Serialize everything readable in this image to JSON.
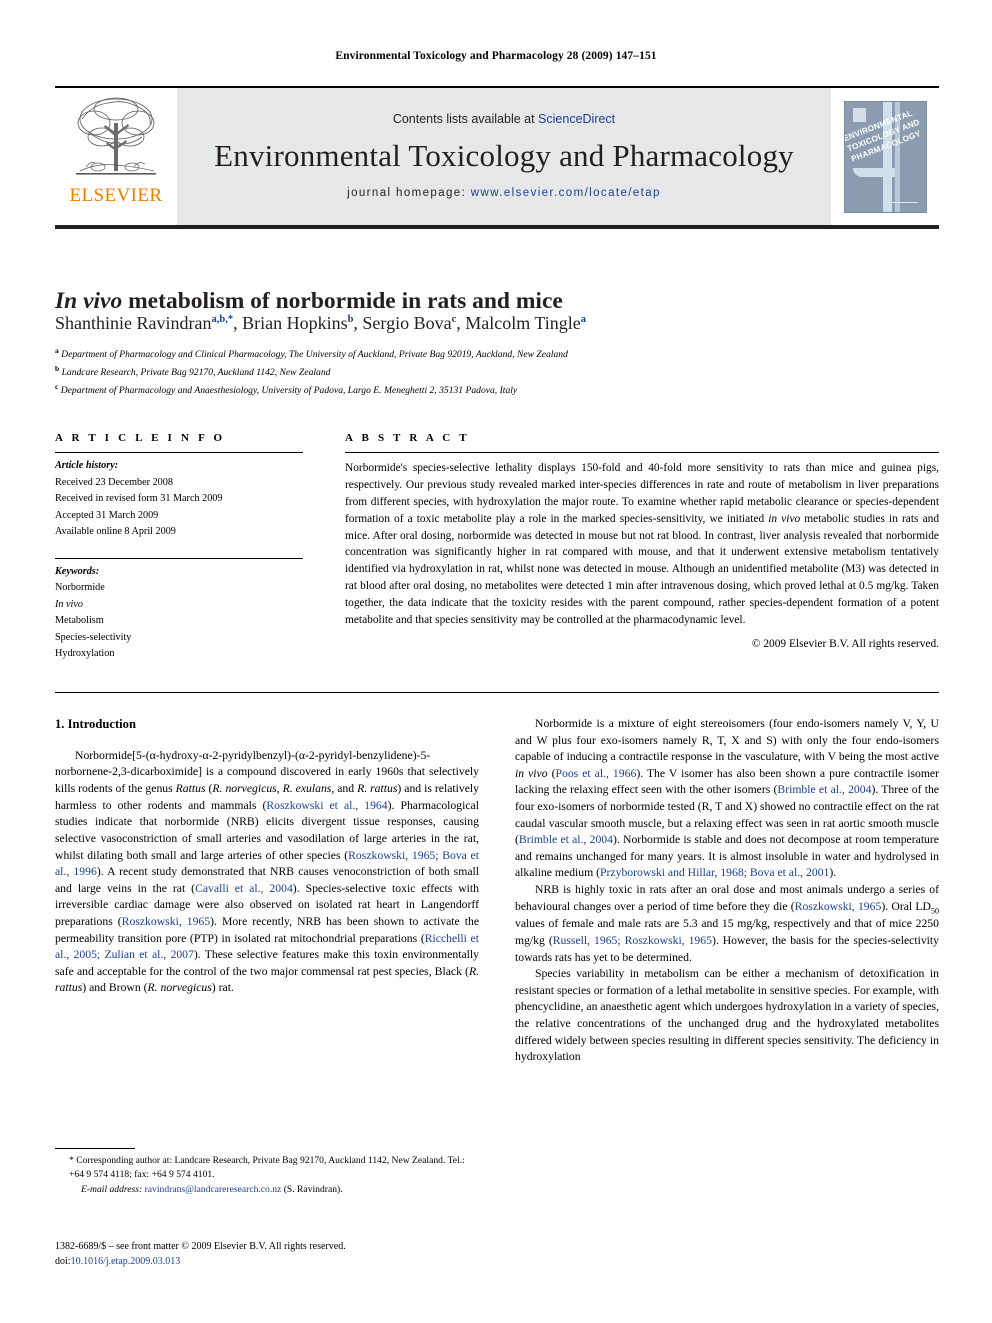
{
  "running_head": "Environmental Toxicology and Pharmacology 28 (2009) 147–151",
  "masthead": {
    "publisher": "ELSEVIER",
    "contents_prefix": "Contents lists available at ",
    "contents_link": "ScienceDirect",
    "journal_name": "Environmental Toxicology and Pharmacology",
    "homepage_prefix": "journal homepage: ",
    "homepage_url": "www.elsevier.com/locate/etap",
    "cover_title": "ENVIRONMENTAL TOXICOLOGY AND PHARMACOLOGY"
  },
  "article": {
    "title_italic": "In vivo",
    "title_rest": " metabolism of norbormide in rats and mice",
    "authors": "Shanthinie Ravindran<sup>a,b,</sup><sup>*</sup>, Brian Hopkins<sup>b</sup>, Sergio Bova<sup>c</sup>, Malcolm Tingle<sup>a</sup>",
    "affiliations": [
      "<sup>a</sup> Department of Pharmacology and Clinical Pharmacology, The University of Auckland, Private Bag 92019, Auckland, New Zealand",
      "<sup>b</sup> Landcare Research, Private Bag 92170, Auckland 1142, New Zealand",
      "<sup>c</sup> Department of Pharmacology and Anaesthesiology, University of Padova, Largo E. Meneghetti 2, 35131 Padova, Italy"
    ]
  },
  "info": {
    "heading": "A R T I C L E    I N F O",
    "history_label": "Article history:",
    "history": [
      "Received 23 December 2008",
      "Received in revised form 31 March 2009",
      "Accepted 31 March 2009",
      "Available online 8 April 2009"
    ],
    "keywords_label": "Keywords:",
    "keywords": [
      "Norbormide",
      "In vivo",
      "Metabolism",
      "Species-selectivity",
      "Hydroxylation"
    ]
  },
  "abstract": {
    "heading": "A B S T R A C T",
    "body": "Norbormide's species-selective lethality displays 150-fold and 40-fold more sensitivity to rats than mice and guinea pigs, respectively. Our previous study revealed marked inter-species differences in rate and route of metabolism in liver preparations from different species, with hydroxylation the major route. To examine whether rapid metabolic clearance or species-dependent formation of a toxic metabolite play a role in the marked species-sensitivity, we initiated <em>in vivo</em> metabolic studies in rats and mice. After oral dosing, norbormide was detected in mouse but not rat blood. In contrast, liver analysis revealed that norbormide concentration was significantly higher in rat compared with mouse, and that it underwent extensive metabolism tentatively identified via hydroxylation in rat, whilst none was detected in mouse. Although an unidentified metabolite (M3) was detected in rat blood after oral dosing, no metabolites were detected 1 min after intravenous dosing, which proved lethal at 0.5 mg/kg. Taken together, the data indicate that the toxicity resides with the parent compound, rather species-dependent formation of a potent metabolite and that species sensitivity may be controlled at the pharmacodynamic level.",
    "copyright": "© 2009 Elsevier B.V. All rights reserved."
  },
  "body": {
    "section_title": "1. Introduction",
    "left_paragraphs": [
      "Norbormide[5-(α-hydroxy-α-2-pyridylbenzyl)-(α-2-pyridyl-benzylidene)-5-norbornene-2,3-dicarboximide] is a compound discovered in early 1960s that selectively kills rodents of the genus <em>Rattus</em> (<em>R. norvegicus</em>, <em>R. exulans</em>, and <em>R. rattus</em>) and is relatively harmless to other rodents and mammals (<span class=\"cite\">Roszkowski et al., 1964</span>). Pharmacological studies indicate that norbormide (NRB) elicits divergent tissue responses, causing selective vasoconstriction of small arteries and vasodilation of large arteries in the rat, whilst dilating both small and large arteries of other species (<span class=\"cite\">Roszkowski, 1965; Bova et al., 1996</span>). A recent study demonstrated that NRB causes venoconstriction of both small and large veins in the rat (<span class=\"cite\">Cavalli et al., 2004</span>). Species-selective toxic effects with irreversible cardiac damage were also observed on isolated rat heart in Langendorff preparations (<span class=\"cite\">Roszkowski, 1965</span>). More recently, NRB has been shown to activate the permeability transition pore (PTP) in isolated rat mitochondrial preparations (<span class=\"cite\">Ricchelli et al., 2005; Zulian et al., 2007</span>). These selective features make this toxin environmentally safe and acceptable for the control of the two major commensal rat pest species, Black (<em>R. rattus</em>) and Brown (<em>R. norvegicus</em>) rat."
    ],
    "right_paragraphs": [
      "Norbormide is a mixture of eight stereoisomers (four endo-isomers namely V, Y, U and W plus four exo-isomers namely R, T, X and S) with only the four endo-isomers capable of inducing a contractile response in the vasculature, with V being the most active <em>in vivo</em> (<span class=\"cite\">Poos et al., 1966</span>). The V isomer has also been shown a pure contractile isomer lacking the relaxing effect seen with the other isomers (<span class=\"cite\">Brimble et al., 2004</span>). Three of the four exo-isomers of norbormide tested (R, T and X) showed no contractile effect on the rat caudal vascular smooth muscle, but a relaxing effect was seen in rat aortic smooth muscle (<span class=\"cite\">Brimble et al., 2004</span>). Norbormide is stable and does not decompose at room temperature and remains unchanged for many years. It is almost insoluble in water and hydrolysed in alkaline medium (<span class=\"cite\">Przyborowski and Hillar, 1968; Bova et al., 2001</span>).",
      "NRB is highly toxic in rats after an oral dose and most animals undergo a series of behavioural changes over a period of time before they die (<span class=\"cite\">Roszkowski, 1965</span>). Oral LD<sub>50</sub> values of female and male rats are 5.3 and 15 mg/kg, respectively and that of mice 2250 mg/kg (<span class=\"cite\">Russell, 1965; Roszkowski, 1965</span>). However, the basis for the species-selectivity towards rats has yet to be determined.",
      "Species variability in metabolism can be either a mechanism of detoxification in resistant species or formation of a lethal metabolite in sensitive species. For example, with phencyclidine, an anaesthetic agent which undergoes hydroxylation in a variety of species, the relative concentrations of the unchanged drug and the hydroxylated metabolites differed widely between species resulting in different species sensitivity. The deficiency in hydroxylation"
    ]
  },
  "footnotes": {
    "corresponding": "* Corresponding author at: Landcare Research, Private Bag 92170, Auckland 1142, New Zealand. Tel.: +64 9 574 4118; fax: +64 9 574 4101.",
    "email_label": "E-mail address:",
    "email_address": "ravindrans@landcareresearch.co.nz",
    "email_suffix": "(S. Ravindran).",
    "issn_line": "1382-6689/$ – see front matter © 2009 Elsevier B.V. All rights reserved.",
    "doi_label": "doi:",
    "doi_value": "10.1016/j.etap.2009.03.013"
  }
}
